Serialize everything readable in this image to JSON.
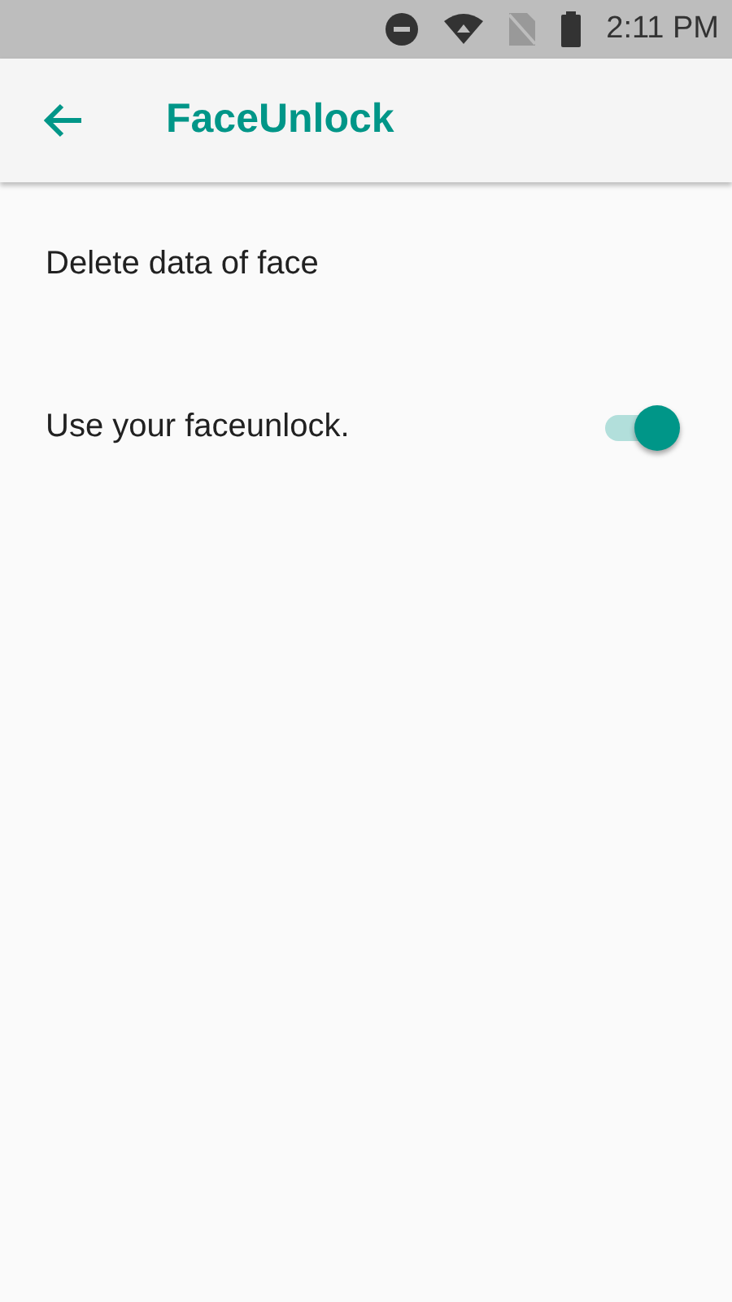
{
  "status_bar": {
    "time": "2:11 PM"
  },
  "app_bar": {
    "title": "FaceUnlock"
  },
  "settings": [
    {
      "kind": "action",
      "label": "Delete data of face"
    },
    {
      "kind": "switch",
      "label": "Use your faceunlock.",
      "on": true
    }
  ]
}
